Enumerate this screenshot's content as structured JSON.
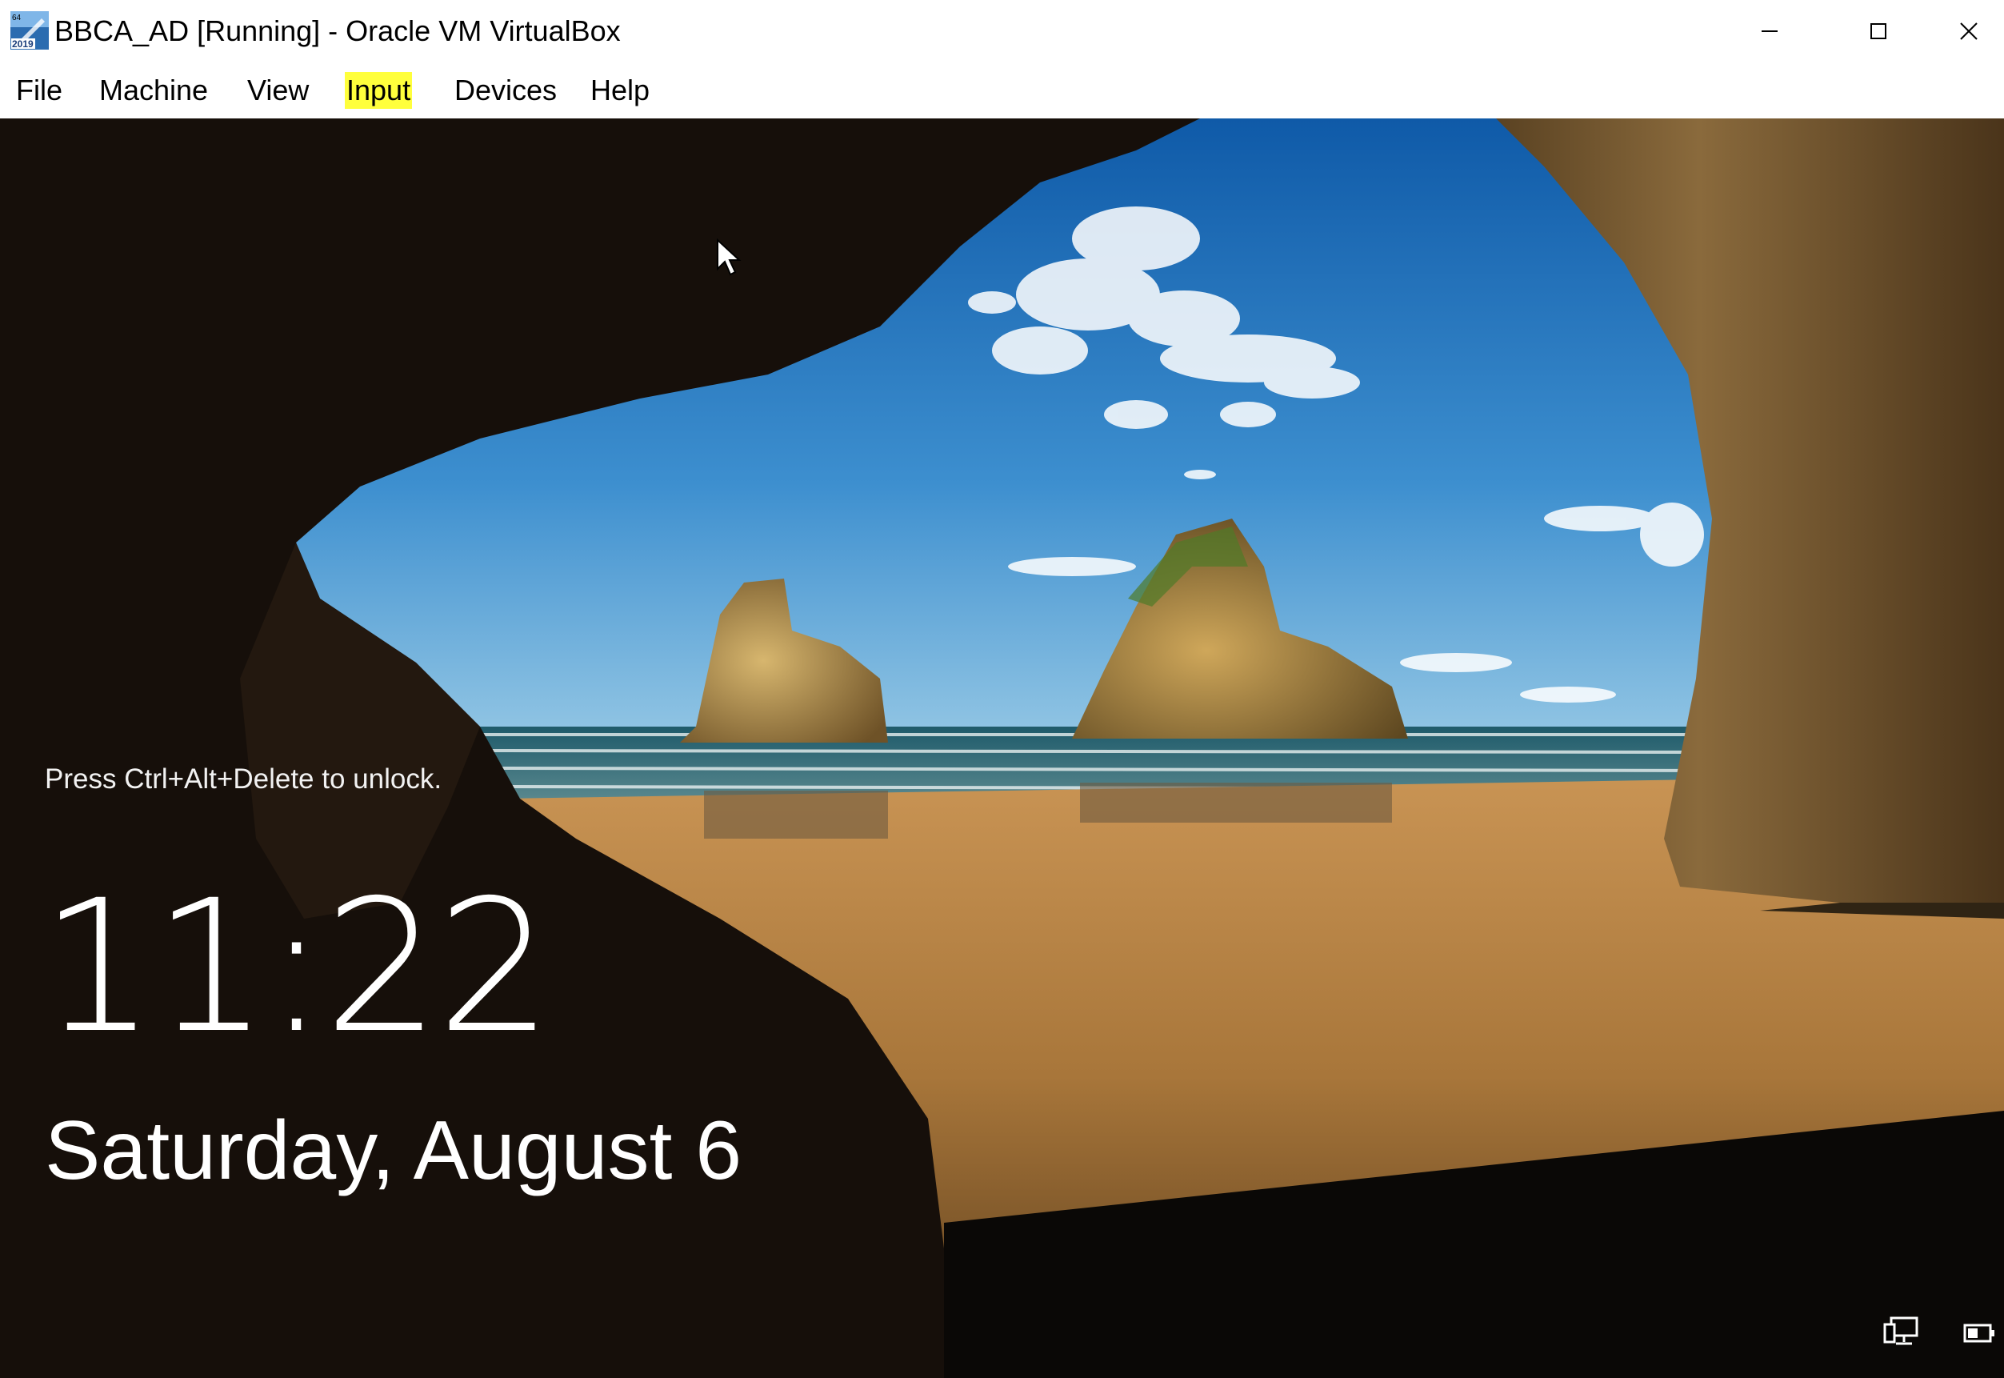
{
  "window": {
    "title": "BBCA_AD [Running] - Oracle VM VirtualBox",
    "app_icon": "virtualbox-vm-icon",
    "app_icon_badge_top": "64",
    "app_icon_badge_bottom": "2019",
    "controls": [
      "minimize-icon",
      "maximize-icon",
      "close-icon"
    ]
  },
  "menu": {
    "items": [
      {
        "label": "File"
      },
      {
        "label": "Machine"
      },
      {
        "label": "View"
      },
      {
        "label": "Input",
        "highlighted": true
      },
      {
        "label": "Devices"
      },
      {
        "label": "Help"
      }
    ],
    "highlight_color": "#ffff3c"
  },
  "lockscreen": {
    "hint": "Press Ctrl+Alt+Delete to unlock.",
    "time": "11:22",
    "date": "Saturday, August 6"
  },
  "tray": {
    "icons": [
      "network-icon",
      "battery-icon"
    ]
  },
  "colors": {
    "sky": "#2f7fc4",
    "sand": "#b8833f",
    "cave": "#1b140e",
    "text": "#ffffff"
  }
}
